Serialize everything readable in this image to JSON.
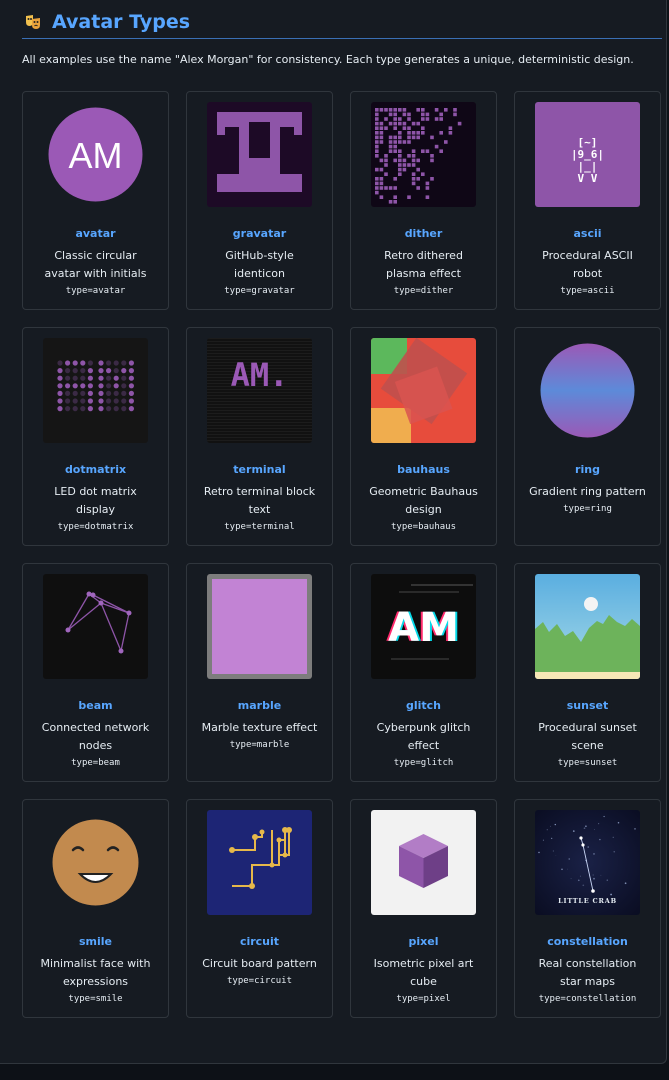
{
  "header": {
    "icon": "theater-masks-icon",
    "title": "Avatar Types"
  },
  "intro": "All examples use the name \"Alex Morgan\" for consistency. Each type generates a unique, deterministic design.",
  "cards": [
    {
      "name": "avatar",
      "desc": "Classic circular avatar with initials",
      "code": "type=avatar",
      "initials": "AM"
    },
    {
      "name": "gravatar",
      "desc": "GitHub-style identicon",
      "code": "type=gravatar"
    },
    {
      "name": "dither",
      "desc": "Retro dithered plasma effect",
      "code": "type=dither"
    },
    {
      "name": "ascii",
      "desc": "Procedural ASCII robot",
      "code": "type=ascii",
      "art": [
        " [~] ",
        "|9_6|",
        " |_| ",
        " V V "
      ]
    },
    {
      "name": "dotmatrix",
      "desc": "LED dot matrix display",
      "code": "type=dotmatrix"
    },
    {
      "name": "terminal",
      "desc": "Retro terminal block text",
      "code": "type=terminal",
      "text": "AM."
    },
    {
      "name": "bauhaus",
      "desc": "Geometric Bauhaus design",
      "code": "type=bauhaus"
    },
    {
      "name": "ring",
      "desc": "Gradient ring pattern",
      "code": "type=ring"
    },
    {
      "name": "beam",
      "desc": "Connected network nodes",
      "code": "type=beam"
    },
    {
      "name": "marble",
      "desc": "Marble texture effect",
      "code": "type=marble"
    },
    {
      "name": "glitch",
      "desc": "Cyberpunk glitch effect",
      "code": "type=glitch",
      "text": "AM"
    },
    {
      "name": "sunset",
      "desc": "Procedural sunset scene",
      "code": "type=sunset"
    },
    {
      "name": "smile",
      "desc": "Minimalist face with expressions",
      "code": "type=smile"
    },
    {
      "name": "circuit",
      "desc": "Circuit board pattern",
      "code": "type=circuit"
    },
    {
      "name": "pixel",
      "desc": "Isometric pixel art cube",
      "code": "type=pixel"
    },
    {
      "name": "constellation",
      "desc": "Real constellation star maps",
      "code": "type=constellation",
      "label": "LITTLE CRAB"
    }
  ],
  "colors": {
    "accent": "#58a6ff",
    "purple": "#9b59b6",
    "card_border": "#30363d",
    "bg": "#161b22"
  }
}
